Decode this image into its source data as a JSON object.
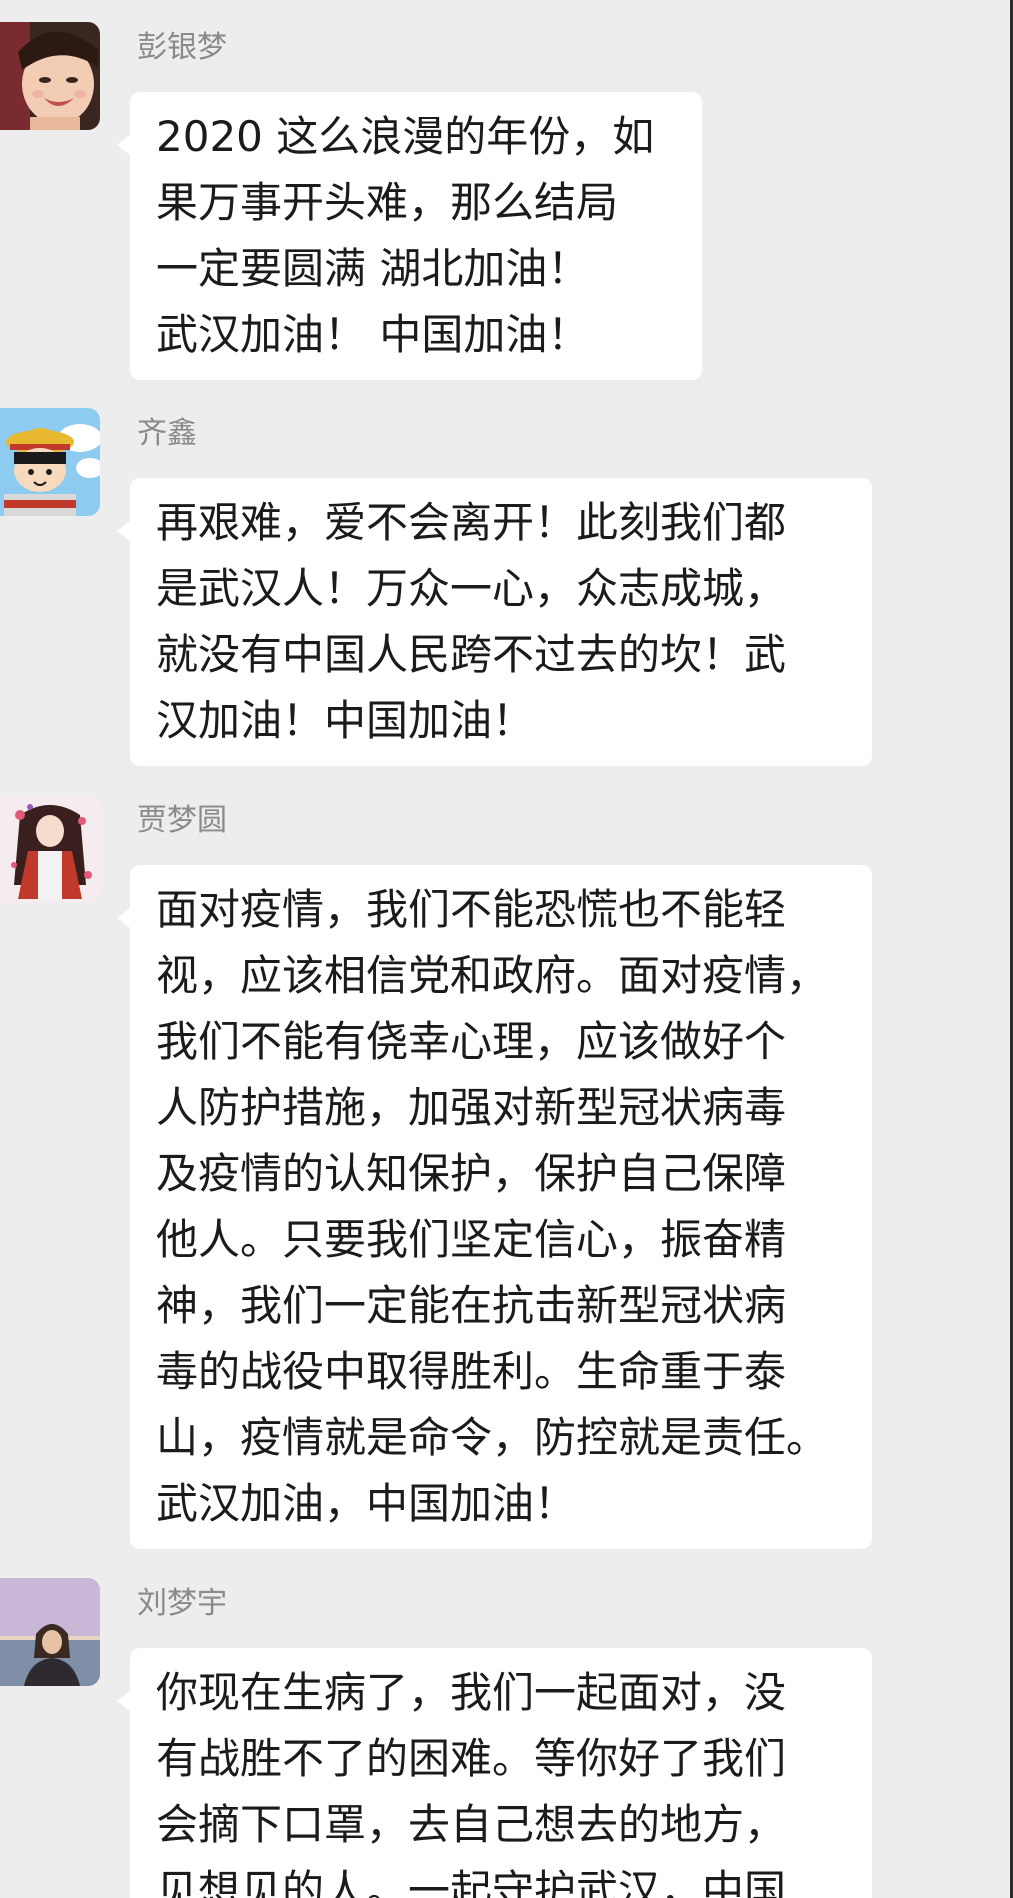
{
  "messages": [
    {
      "sender": "彭银梦",
      "avatar_icon": "girl-photo-avatar",
      "lines": [
        "2020 这么浪漫的年份，如",
        "果万事开头难，那么结局",
        "一定要圆满 湖北加油！",
        "武汉加油！ 中国加油！"
      ]
    },
    {
      "sender": "齐鑫",
      "avatar_icon": "cartoon-girl-avatar",
      "lines": [
        "再艰难，爱不会离开！此刻我们都",
        "是武汉人！万众一心，众志成城，",
        "就没有中国人民跨不过去的坎！武",
        "汉加油！中国加油！"
      ]
    },
    {
      "sender": "贾梦圆",
      "avatar_icon": "anime-character-avatar",
      "lines": [
        "面对疫情，我们不能恐慌也不能轻",
        "视，应该相信党和政府。面对疫情，",
        "我们不能有侥幸心理，应该做好个",
        "人防护措施，加强对新型冠状病毒",
        "及疫情的认知保护，保护自己保障",
        "他人。只要我们坚定信心，振奋精",
        "神，我们一定能在抗击新型冠状病",
        "毒的战役中取得胜利。生命重于泰",
        "山，疫情就是命令，防控就是责任。",
        "武汉加油，中国加油！"
      ]
    },
    {
      "sender": "刘梦宇",
      "avatar_icon": "seaside-portrait-avatar",
      "lines": [
        "你现在生病了，我们一起面对，没",
        "有战胜不了的困难。等你好了我们",
        "会摘下口罩，去自己想去的地方，",
        "见想见的人。一起守护武汉，中国"
      ]
    }
  ],
  "colors": {
    "background": "#ededed",
    "bubble": "#ffffff",
    "sender_name": "#8a8a8a",
    "message_text": "#1b1b1b"
  }
}
